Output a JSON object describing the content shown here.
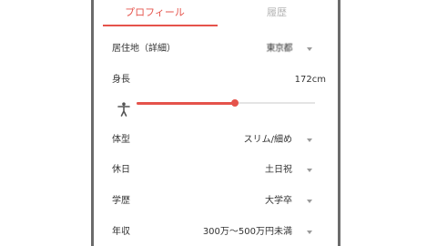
{
  "tabs": [
    {
      "label": "プロフィール",
      "active": true
    },
    {
      "label": "履歴",
      "active": false
    }
  ],
  "accent_color": "#e5534b",
  "rows": {
    "residence": {
      "label": "居住地（詳細）",
      "value": "東京都"
    },
    "height": {
      "label": "身長",
      "value": "172cm",
      "slider_fraction": 0.55
    },
    "body_type": {
      "label": "体型",
      "value": "スリム/細め"
    },
    "holiday": {
      "label": "休日",
      "value": "土日祝"
    },
    "education": {
      "label": "学歴",
      "value": "大学卒"
    },
    "income": {
      "label": "年収",
      "value": "300万～500万円未満"
    }
  },
  "icons": {
    "slider": "person-icon",
    "dropdown": "chevron-down-icon"
  }
}
